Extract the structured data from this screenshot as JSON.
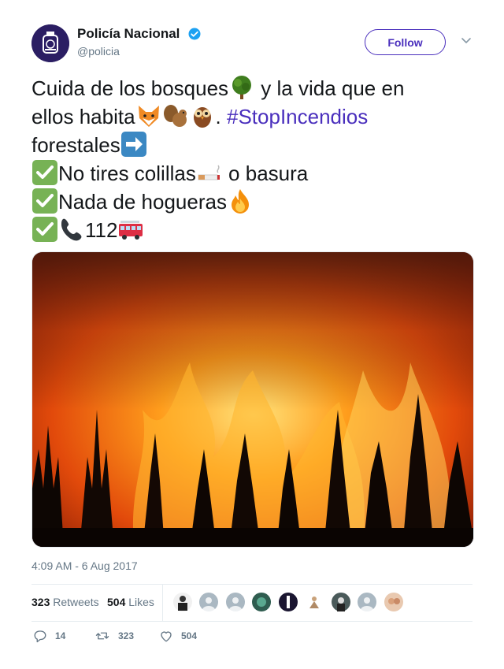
{
  "author": {
    "display_name": "Policía Nacional",
    "handle": "@policia",
    "verified": true
  },
  "follow_label": "Follow",
  "tweet": {
    "line1_a": "Cuida de los bosques",
    "line1_b": " y la vida que en",
    "line2_a": "ellos habita",
    "line2_b": ". ",
    "hashtag": "#StopIncendios",
    "line3": "forestales",
    "line4_a": "No tires colillas",
    "line4_b": " o basura",
    "line5": "Nada de hogueras",
    "line6": "112"
  },
  "media": {
    "description_icon": "forest-fire-photo"
  },
  "timestamp": "4:09 AM - 6 Aug 2017",
  "stats": {
    "retweets_count": "323",
    "retweets_label": "Retweets",
    "likes_count": "504",
    "likes_label": "Likes"
  },
  "actions": {
    "replies": "14",
    "retweets": "323",
    "likes": "504"
  },
  "colors": {
    "accent": "#4a2fbd",
    "text": "#14171a",
    "muted": "#657786",
    "border": "#e6ecf0",
    "verified": "#1da1f2"
  }
}
